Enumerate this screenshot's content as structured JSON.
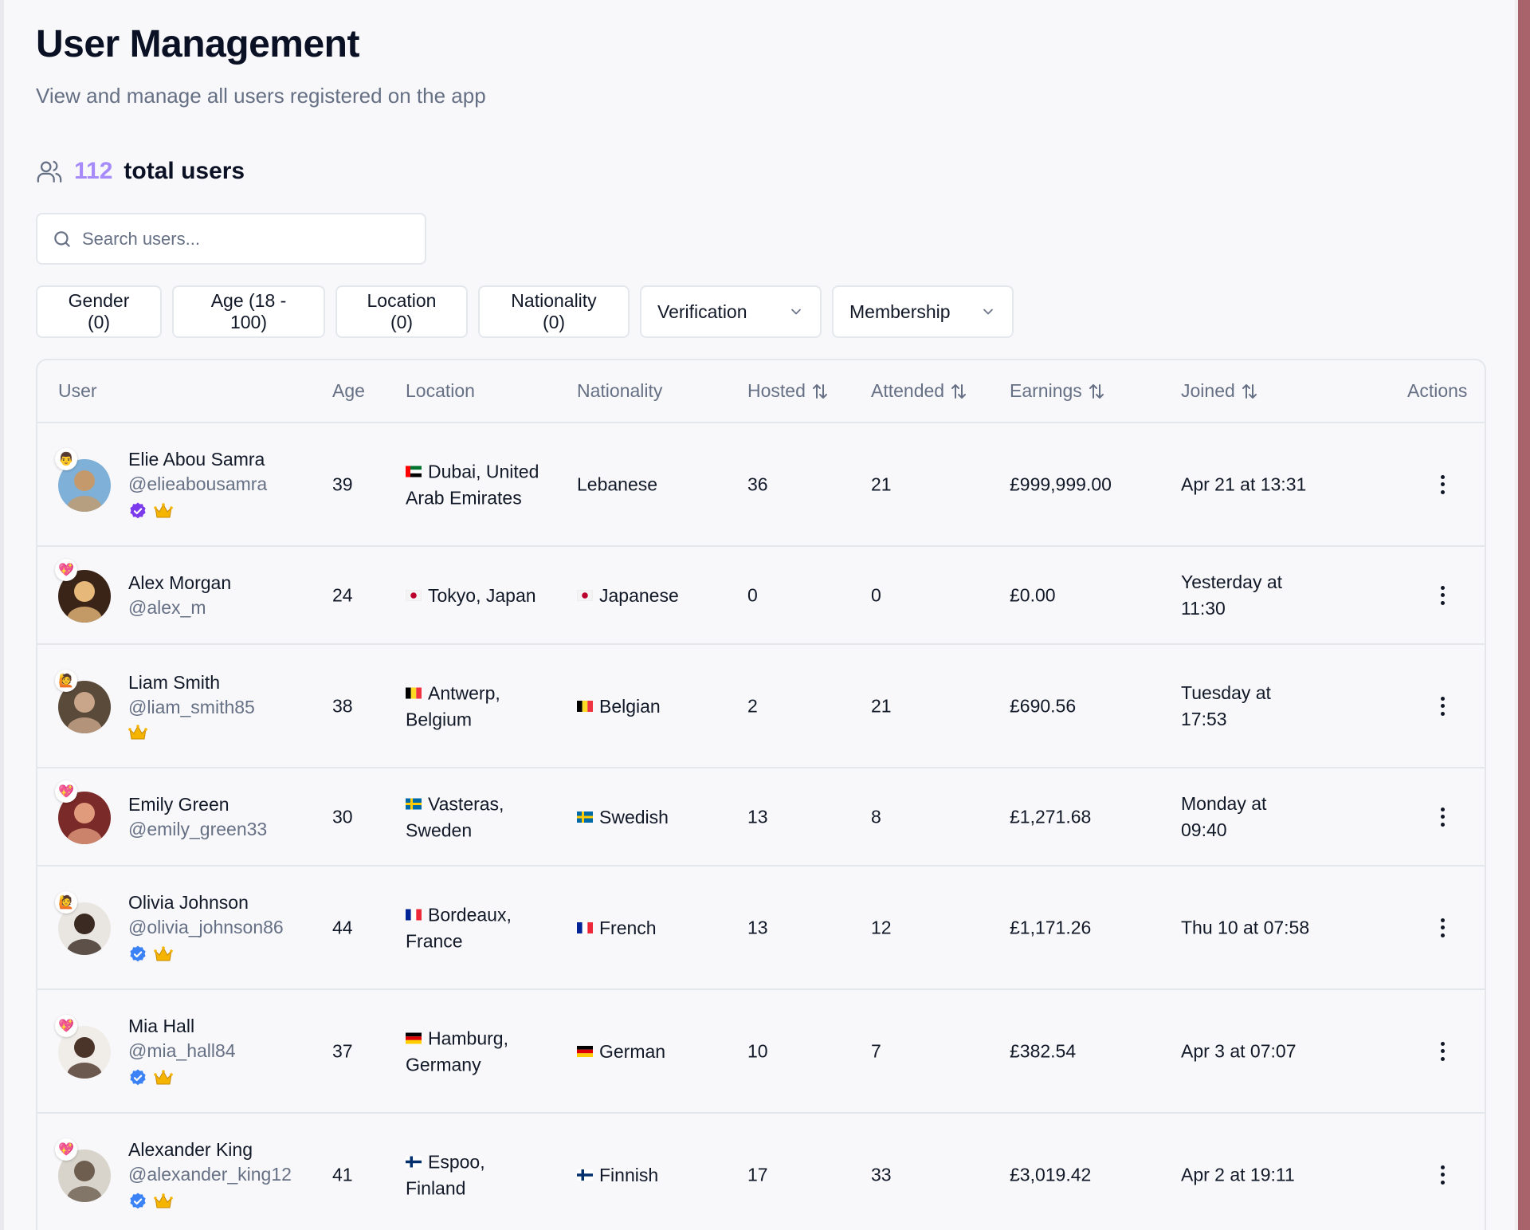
{
  "header": {
    "title": "User Management",
    "subtitle": "View and manage all users registered on the app",
    "user_count": "112",
    "user_count_label": "total users"
  },
  "search": {
    "placeholder": "Search users..."
  },
  "filters": {
    "gender": "Gender (0)",
    "age": "Age (18 - 100)",
    "location": "Location (0)",
    "nationality": "Nationality (0)",
    "verification": "Verification",
    "membership": "Membership"
  },
  "table": {
    "columns": {
      "user": "User",
      "age": "Age",
      "location": "Location",
      "nationality": "Nationality",
      "hosted": "Hosted",
      "attended": "Attended",
      "earnings": "Earnings",
      "joined": "Joined",
      "actions": "Actions"
    },
    "rows": [
      {
        "name": "Elie Abou Samra",
        "handle": "@elieabousamra",
        "age": "39",
        "location_1": "Dubai, United",
        "location_2": "Arab Emirates",
        "nationality": "Lebanese",
        "hosted": "36",
        "attended": "21",
        "earnings": "£999,999.00",
        "joined_1": "Apr 21 at 13:31",
        "joined_2": "",
        "flag": "ae",
        "nat_flag": "",
        "verified": true,
        "verified_color": "#7c3aed",
        "crown": true,
        "badge": "👨"
      },
      {
        "name": "Alex Morgan",
        "handle": "@alex_m",
        "age": "24",
        "location_1": "Tokyo, Japan",
        "location_2": "",
        "nationality": "Japanese",
        "hosted": "0",
        "attended": "0",
        "earnings": "£0.00",
        "joined_1": "Yesterday at",
        "joined_2": "11:30",
        "flag": "jp",
        "nat_flag": "jp",
        "verified": false,
        "crown": false,
        "badge": "💖"
      },
      {
        "name": "Liam Smith",
        "handle": "@liam_smith85",
        "age": "38",
        "location_1": "Antwerp,",
        "location_2": "Belgium",
        "nationality": "Belgian",
        "hosted": "2",
        "attended": "21",
        "earnings": "£690.56",
        "joined_1": "Tuesday at",
        "joined_2": "17:53",
        "flag": "be",
        "nat_flag": "be",
        "verified": false,
        "crown": true,
        "badge": "🙋"
      },
      {
        "name": "Emily Green",
        "handle": "@emily_green33",
        "age": "30",
        "location_1": "Vasteras,",
        "location_2": "Sweden",
        "nationality": "Swedish",
        "hosted": "13",
        "attended": "8",
        "earnings": "£1,271.68",
        "joined_1": "Monday at",
        "joined_2": "09:40",
        "flag": "se",
        "nat_flag": "se",
        "verified": false,
        "crown": false,
        "badge": "💖"
      },
      {
        "name": "Olivia Johnson",
        "handle": "@olivia_johnson86",
        "age": "44",
        "location_1": "Bordeaux,",
        "location_2": "France",
        "nationality": "French",
        "hosted": "13",
        "attended": "12",
        "earnings": "£1,171.26",
        "joined_1": "Thu 10 at 07:58",
        "joined_2": "",
        "flag": "fr",
        "nat_flag": "fr",
        "verified": true,
        "verified_color": "#3b82f6",
        "crown": true,
        "badge": "🙋"
      },
      {
        "name": "Mia Hall",
        "handle": "@mia_hall84",
        "age": "37",
        "location_1": "Hamburg,",
        "location_2": "Germany",
        "nationality": "German",
        "hosted": "10",
        "attended": "7",
        "earnings": "£382.54",
        "joined_1": "Apr 3 at 07:07",
        "joined_2": "",
        "flag": "de",
        "nat_flag": "de",
        "verified": true,
        "verified_color": "#3b82f6",
        "crown": true,
        "badge": "💖"
      },
      {
        "name": "Alexander King",
        "handle": "@alexander_king12",
        "age": "41",
        "location_1": "Espoo,",
        "location_2": "Finland",
        "nationality": "Finnish",
        "hosted": "17",
        "attended": "33",
        "earnings": "£3,019.42",
        "joined_1": "Apr 2 at 19:11",
        "joined_2": "",
        "flag": "fi",
        "nat_flag": "fi",
        "verified": true,
        "verified_color": "#3b82f6",
        "crown": true,
        "badge": "💖"
      }
    ]
  }
}
